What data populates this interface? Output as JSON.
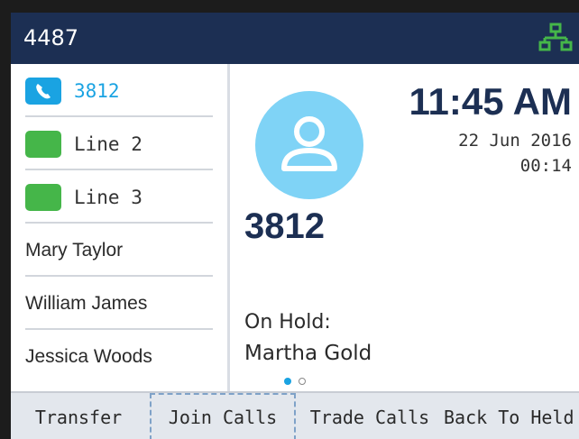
{
  "header": {
    "extension": "4487",
    "network_icon": "network-icon"
  },
  "sidebar": {
    "line_keys": [
      {
        "label": "3812",
        "icon": "phone-icon",
        "state": "active"
      },
      {
        "label": "Line 2",
        "state": "idle"
      },
      {
        "label": "Line 3",
        "state": "idle"
      }
    ],
    "contacts": [
      {
        "label": "Mary Taylor"
      },
      {
        "label": "William James"
      },
      {
        "label": "Jessica Woods"
      }
    ]
  },
  "call": {
    "time": "11:45 AM",
    "date": "22 Jun 2016",
    "duration": "00:14",
    "number": "3812",
    "hold_label": "On Hold:",
    "hold_name": "Martha Gold"
  },
  "softkeys": {
    "transfer": "Transfer",
    "join": "Join Calls",
    "trade": "Trade Calls",
    "back": "Back To Held"
  },
  "colors": {
    "header": "#1c2f53",
    "accent": "#1aa3e2",
    "line_green": "#45b649",
    "avatar": "#7fd3f6"
  }
}
